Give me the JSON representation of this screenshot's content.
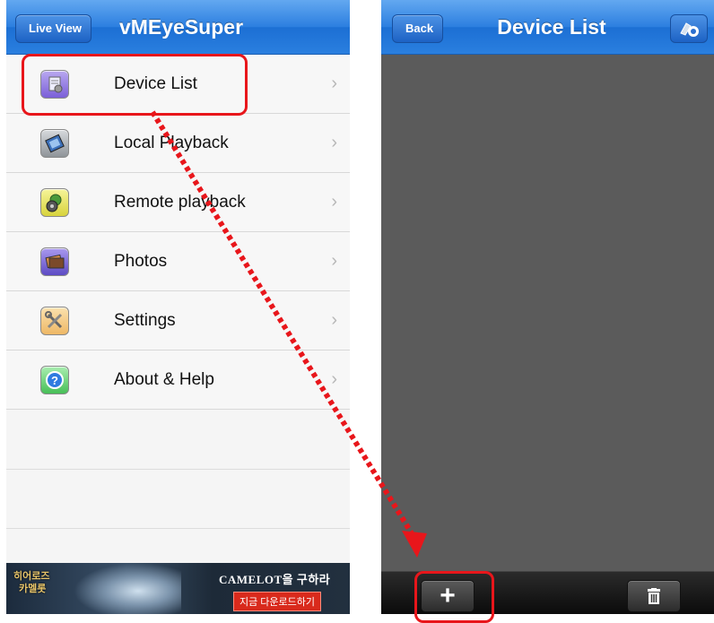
{
  "left_screen": {
    "back_button_label": "Live View",
    "title": "vMEyeSuper",
    "menu_items": [
      {
        "label": "Device List",
        "icon": "device-list-icon",
        "color": "#8c6ee0"
      },
      {
        "label": "Local Playback",
        "icon": "film-icon",
        "color": "#9ea3a8"
      },
      {
        "label": "Remote playback",
        "icon": "globe-reel-icon",
        "color": "#e4e25a"
      },
      {
        "label": "Photos",
        "icon": "photos-icon",
        "color": "#7a6bd6"
      },
      {
        "label": "Settings",
        "icon": "tools-icon",
        "color": "#f0c27a"
      },
      {
        "label": "About & Help",
        "icon": "help-icon",
        "color": "#6fd37a"
      }
    ],
    "chevron": "›",
    "ad": {
      "logo_text_1": "히어로즈",
      "logo_text_2": "카멜롯",
      "headline": "CAMELOT을 구하라",
      "cta": "지금 다운로드하기"
    }
  },
  "right_screen": {
    "back_button_label": "Back",
    "title": "Device List",
    "add_label": "+",
    "delete_icon": "trash-icon",
    "settings_icon": "camera-gear-icon"
  },
  "annotation": {
    "highlight_color": "#e8161b",
    "arrow_style": "dotted-red"
  }
}
